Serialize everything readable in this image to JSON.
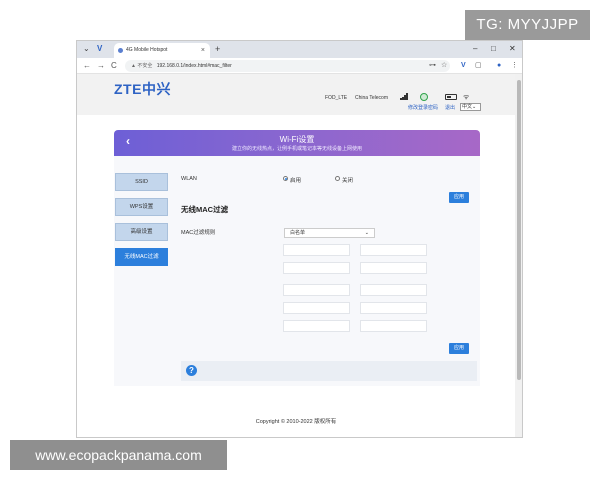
{
  "watermarks": {
    "tg": "TG: MYYJJPP",
    "site": "www.ecopackpanama.com"
  },
  "browser": {
    "tab_title": "4G Mobile Hotspot",
    "tab_close": "×",
    "new_tab": "+",
    "back": "←",
    "forward": "→",
    "reload": "C",
    "insecure_label": "▲ 不安全",
    "url": "192.168.0.1/index.html#mac_filter",
    "win_min": "–",
    "win_max": "□",
    "win_close": "✕",
    "key_icon": "⊶",
    "star_icon": "☆",
    "profile_icon": "●",
    "menu_icon": "⋮"
  },
  "router": {
    "logo": "ZTE中兴",
    "network_name": "FOD_LTE",
    "carrier": "China Telecom",
    "links": {
      "change_password": "修改登录密码",
      "logout": "退出"
    },
    "language": "中文",
    "language_chevron": "⌄",
    "wifi_glyph": "ᯤ"
  },
  "page": {
    "title": "Wi-Fi设置",
    "subtitle": "建立你的无线热点，让例手机或笔记本等无线设备上网使用",
    "back_glyph": "‹"
  },
  "menu": {
    "items": [
      {
        "label": "SSID"
      },
      {
        "label": "WPS设置"
      },
      {
        "label": "高级设置"
      },
      {
        "label": "无线MAC过滤"
      }
    ],
    "active_index": 3
  },
  "wlan": {
    "label": "WLAN",
    "enable": "启用",
    "disable": "关闭",
    "selected": "启用",
    "apply": "应用"
  },
  "mac_filter": {
    "section_title": "无线MAC过滤",
    "rule_label": "MAC过滤规则",
    "rule_value": "白名单",
    "rule_chevron": "⌄",
    "apply": "应用",
    "entries": [
      "",
      "",
      "",
      "",
      "",
      "",
      "",
      "",
      "",
      ""
    ]
  },
  "help_icon": "?",
  "footer": "Copyright © 2010-2022 版权所有",
  "colors": {
    "accent": "#2c7fdc",
    "banner_start": "#6d5fd6",
    "banner_end": "#a768c7",
    "logo": "#2e63c4"
  }
}
